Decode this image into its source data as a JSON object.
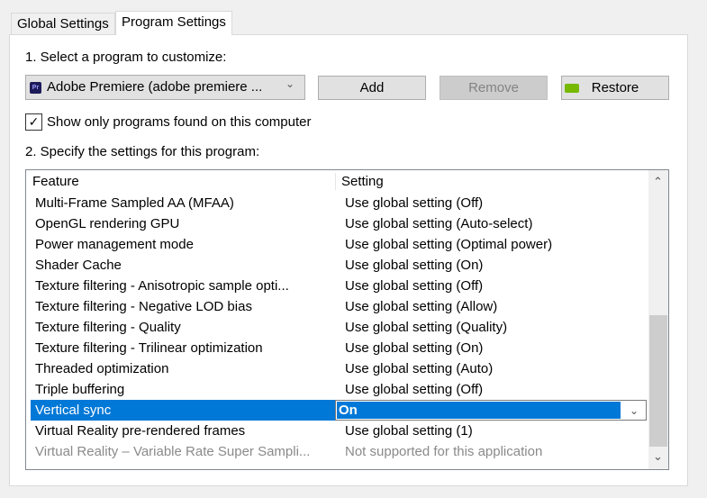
{
  "tabs": [
    {
      "label": "Global Settings",
      "active": false
    },
    {
      "label": "Program Settings",
      "active": true
    }
  ],
  "step1_label": "1. Select a program to customize:",
  "program_select": {
    "value": "Adobe Premiere (adobe premiere ...",
    "icon": "premiere-pro-icon"
  },
  "buttons": {
    "add": "Add",
    "remove": "Remove",
    "restore": "Restore"
  },
  "show_only_checkbox": {
    "label": "Show only programs found on this computer",
    "checked": true
  },
  "step2_label": "2. Specify the settings for this program:",
  "table": {
    "headers": {
      "feature": "Feature",
      "setting": "Setting"
    },
    "rows": [
      {
        "feature": "Multi-Frame Sampled AA (MFAA)",
        "setting": "Use global setting (Off)"
      },
      {
        "feature": "OpenGL rendering GPU",
        "setting": "Use global setting (Auto-select)"
      },
      {
        "feature": "Power management mode",
        "setting": "Use global setting (Optimal power)"
      },
      {
        "feature": "Shader Cache",
        "setting": "Use global setting (On)"
      },
      {
        "feature": "Texture filtering - Anisotropic sample opti...",
        "setting": "Use global setting (Off)"
      },
      {
        "feature": "Texture filtering - Negative LOD bias",
        "setting": "Use global setting (Allow)"
      },
      {
        "feature": "Texture filtering - Quality",
        "setting": "Use global setting (Quality)"
      },
      {
        "feature": "Texture filtering - Trilinear optimization",
        "setting": "Use global setting (On)"
      },
      {
        "feature": "Threaded optimization",
        "setting": "Use global setting (Auto)"
      },
      {
        "feature": "Triple buffering",
        "setting": "Use global setting (Off)"
      },
      {
        "feature": "Vertical sync",
        "setting": "On",
        "selected": true
      },
      {
        "feature": "Virtual Reality pre-rendered frames",
        "setting": "Use global setting (1)"
      },
      {
        "feature": "Virtual Reality – Variable Rate Super Sampli...",
        "setting": "Not supported for this application",
        "disabled": true
      }
    ]
  },
  "colors": {
    "selection": "#0078d7",
    "nvidia_green": "#76b900"
  }
}
